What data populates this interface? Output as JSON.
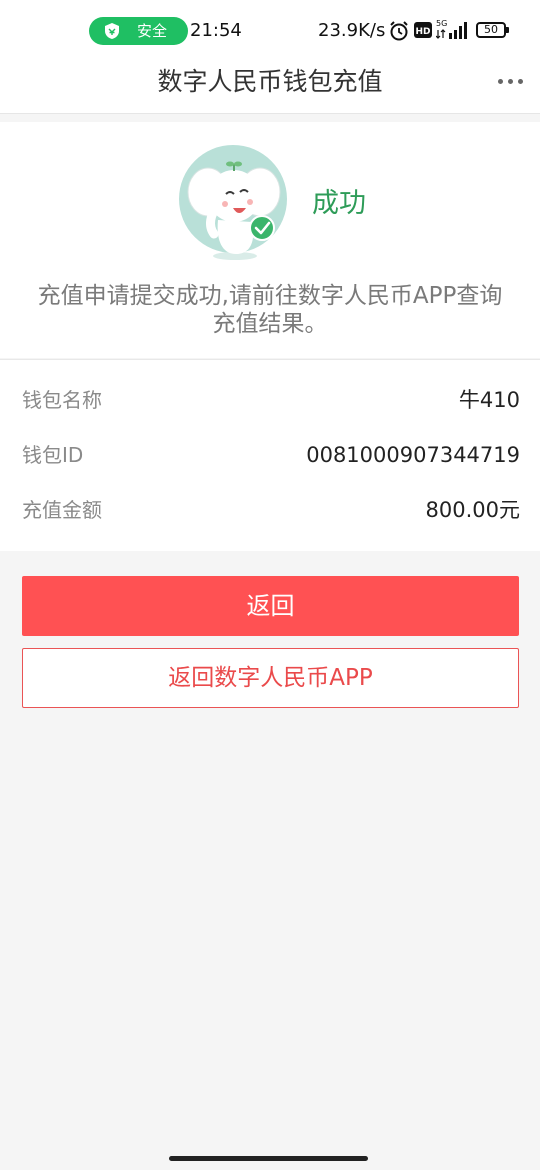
{
  "status_bar": {
    "security_label": "安全",
    "time": "21:54",
    "network_speed": "23.9K/s",
    "network_type": "5G",
    "battery_level": "50",
    "security_color": "#1fbf63"
  },
  "nav": {
    "title": "数字人民币钱包充值",
    "more_icon": "more-dots-icon"
  },
  "result": {
    "status_text": "成功",
    "message": "充值申请提交成功,请前往数字人民币APP查询充值结果。",
    "status_color": "#2e9c58",
    "mascot_icon": "elephant-mascot-success-icon"
  },
  "details": {
    "rows": [
      {
        "label": "钱包名称",
        "value": "牛410"
      },
      {
        "label": "钱包ID",
        "value": "0081000907344719"
      },
      {
        "label": "充值金额",
        "value": "800.00元"
      }
    ]
  },
  "actions": {
    "back_label": "返回",
    "back_to_app_label": "返回数字人民币APP",
    "primary_color": "#ff5153"
  }
}
